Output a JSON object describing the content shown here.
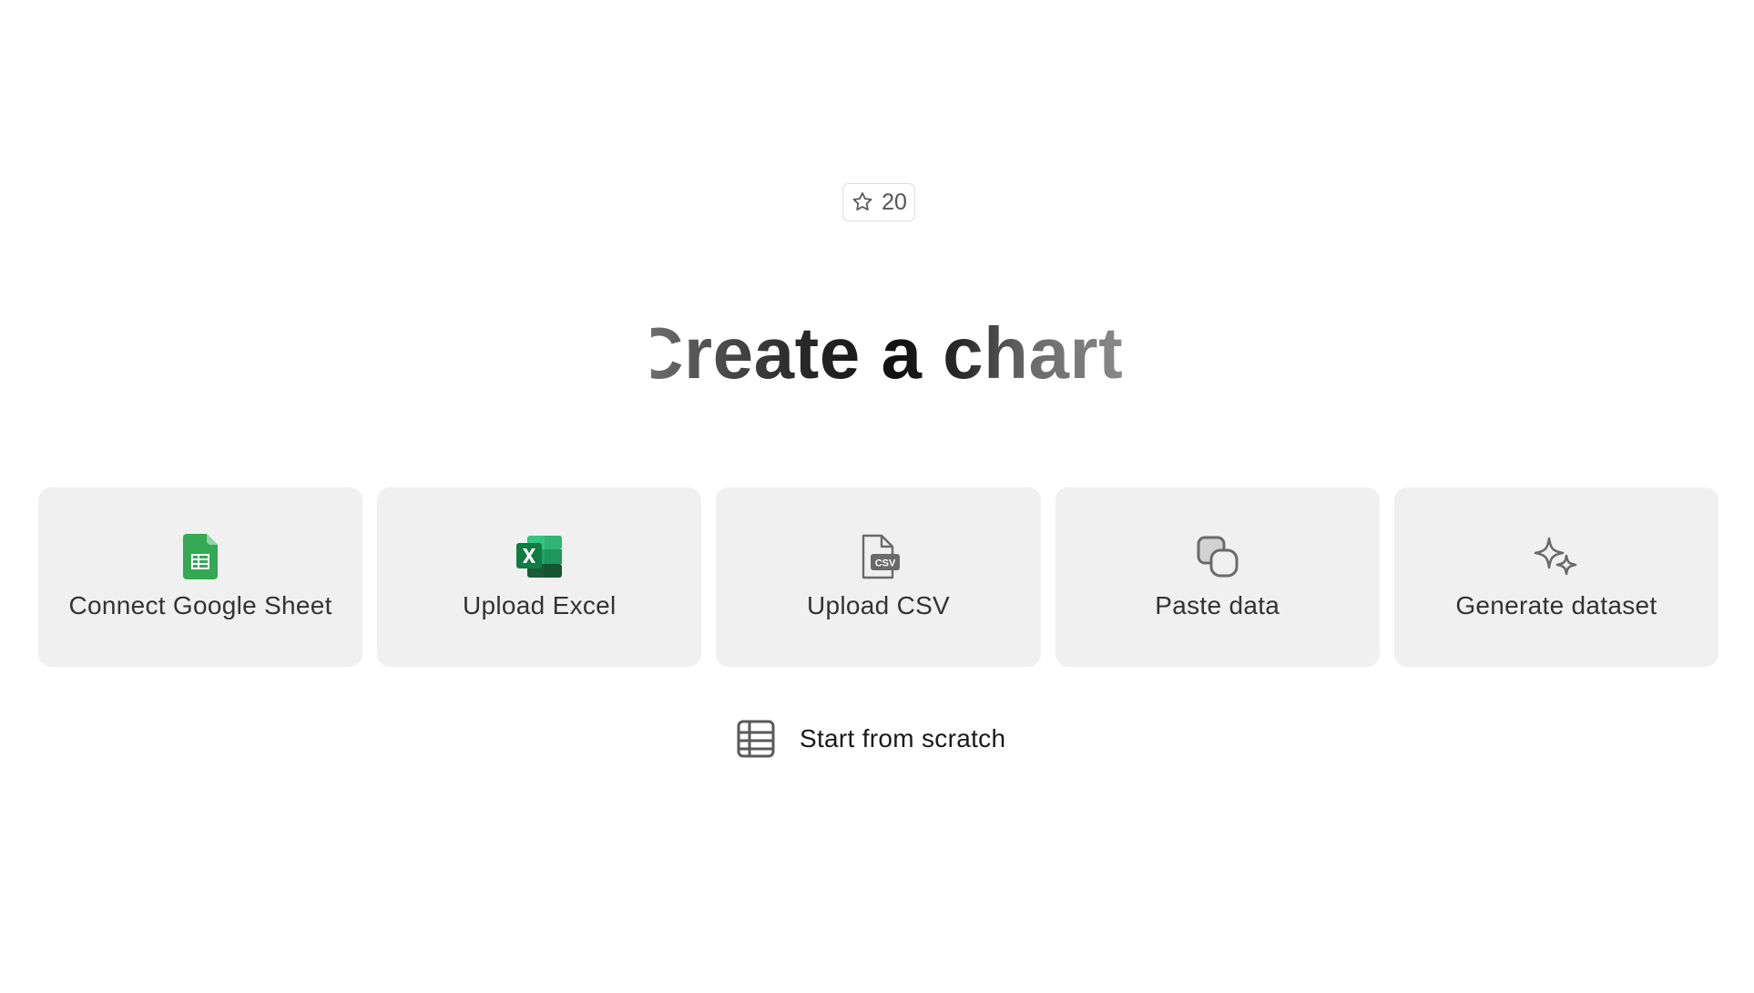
{
  "star_badge": {
    "icon": "star-icon",
    "count": "20"
  },
  "title": "Create a chart",
  "cards": [
    {
      "label": "Connect Google Sheet",
      "icon": "google-sheets-icon"
    },
    {
      "label": "Upload Excel",
      "icon": "excel-icon"
    },
    {
      "label": "Upload CSV",
      "icon": "csv-file-icon"
    },
    {
      "label": "Paste data",
      "icon": "copy-icon"
    },
    {
      "label": "Generate dataset",
      "icon": "sparkles-icon"
    }
  ],
  "scratch": {
    "label": "Start from scratch",
    "icon": "table-icon"
  },
  "colors": {
    "card_background": "#f0f0f0",
    "sheets_green": "#34a853",
    "excel_green": "#1d6f42",
    "text_dark": "#333333"
  }
}
